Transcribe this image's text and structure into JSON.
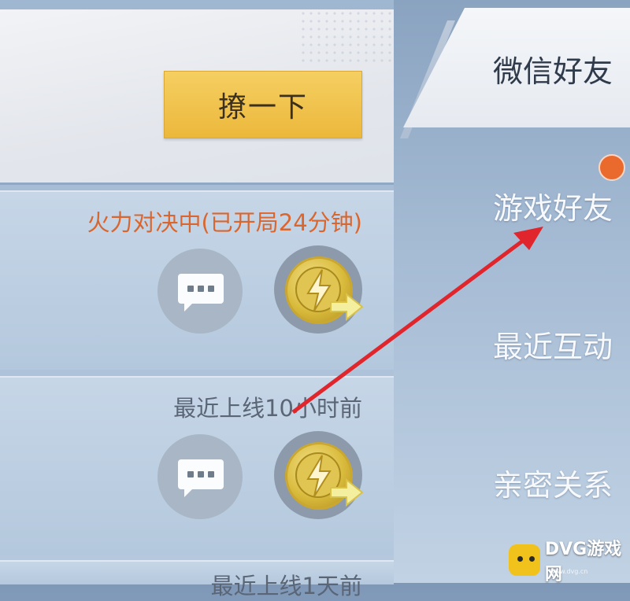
{
  "top": {
    "poke_button_label": "撩一下"
  },
  "friends": [
    {
      "status": "火力对决中(已开局24分钟)",
      "kind": "fight"
    },
    {
      "status": "最近上线10小时前",
      "kind": "offline"
    },
    {
      "status": "最近上线1天前",
      "kind": "offline"
    }
  ],
  "tabs": [
    {
      "label": "微信好友",
      "active": true
    },
    {
      "label": "游戏好友",
      "active": false
    },
    {
      "label": "最近互动",
      "active": false
    },
    {
      "label": "亲密关系",
      "active": false
    }
  ],
  "watermark": {
    "brand": "DVG游戏网",
    "domain": "www.dvg.cn"
  },
  "colors": {
    "accent": "#ecb83b",
    "notify": "#ea6a2e",
    "fight_status": "#d9662f",
    "annotation_arrow": "#e0262c"
  },
  "icons": [
    "chat-bubble-icon",
    "lightning-coin-icon",
    "send-arrow-icon",
    "notification-dot"
  ]
}
